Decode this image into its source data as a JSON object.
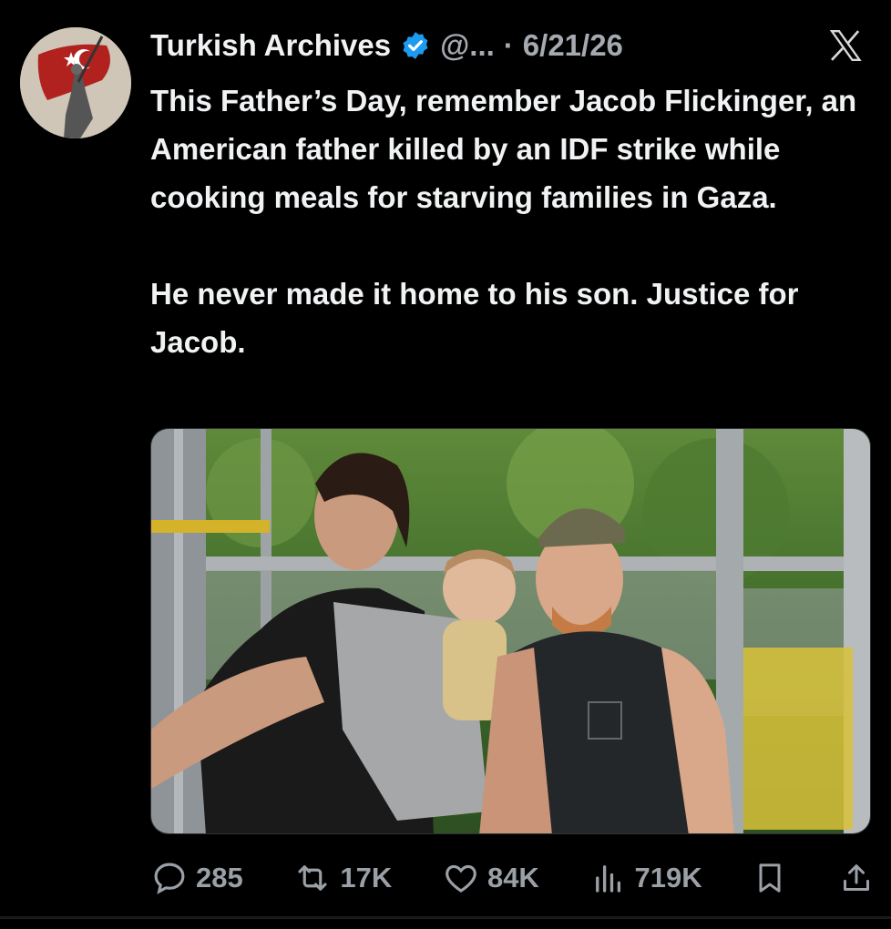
{
  "author": {
    "display_name": "Turkish Archives",
    "handle": "@...",
    "separator": "·",
    "date": "6/21/26",
    "verified": true,
    "avatar_icon": "turkish-flag-statue-avatar"
  },
  "platform_logo": "x-logo",
  "tweet": {
    "paragraphs": [
      "This Father’s Day, remember Jacob Flickinger, an American father killed by an IDF strike while cooking meals for starving families in Gaza.",
      "He never made it home to his son. Justice for Jacob."
    ]
  },
  "media": {
    "type": "photo",
    "subject": "family-photo"
  },
  "actions": {
    "replies": "285",
    "reposts": "17K",
    "likes": "84K",
    "views": "719K"
  },
  "colors": {
    "background": "#000000",
    "text": "#f1f2f3",
    "muted": "#9aa0a6",
    "verified_blue": "#1d9bf0"
  }
}
